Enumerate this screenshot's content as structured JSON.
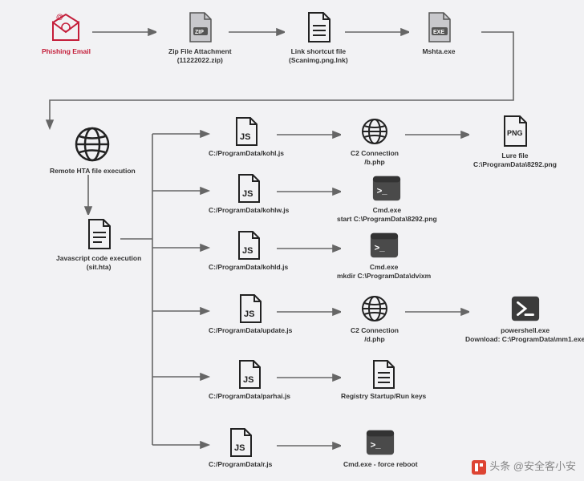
{
  "nodes": {
    "phishing": {
      "title": "Phishing Email"
    },
    "zip": {
      "title": "Zip File Attachment\n(11222022.zip)",
      "badge": "ZIP"
    },
    "lnk": {
      "title": "Link shortcut file\n(Scanimg.png.lnk)"
    },
    "mshta": {
      "title": "Mshta.exe",
      "badge": "EXE"
    },
    "remote_hta": {
      "title": "Remote HTA file execution"
    },
    "js_exec": {
      "title": "Javascript code execution\n(sit.hta)"
    },
    "js1": {
      "title": "C:/ProgramData/kohl.js"
    },
    "c2_b": {
      "title": "C2 Connection\n/b.php"
    },
    "lure": {
      "title": "Lure file\nC:\\ProgramData\\8292.png",
      "badge": "PNG"
    },
    "js2": {
      "title": "C:/ProgramData/kohlw.js"
    },
    "cmd1": {
      "title": "Cmd.exe\nstart C:\\ProgramData\\8292.png"
    },
    "js3": {
      "title": "C:/ProgramData/kohld.js"
    },
    "cmd2": {
      "title": "Cmd.exe\nmkdir C:\\ProgramData\\dvixm"
    },
    "js4": {
      "title": "C:/ProgramData/update.js"
    },
    "c2_d": {
      "title": "C2 Connection\n/d.php"
    },
    "ps": {
      "title": "powershell.exe\nDownload: C:\\ProgramData\\mm1.exe"
    },
    "js5": {
      "title": "C:/ProgramData/parhai.js"
    },
    "reg": {
      "title": "Registry Startup/Run keys"
    },
    "js6": {
      "title": "C:/ProgramData/r.js"
    },
    "cmd3": {
      "title": "Cmd.exe - force reboot"
    }
  },
  "watermark": "头条 @安全客小安"
}
